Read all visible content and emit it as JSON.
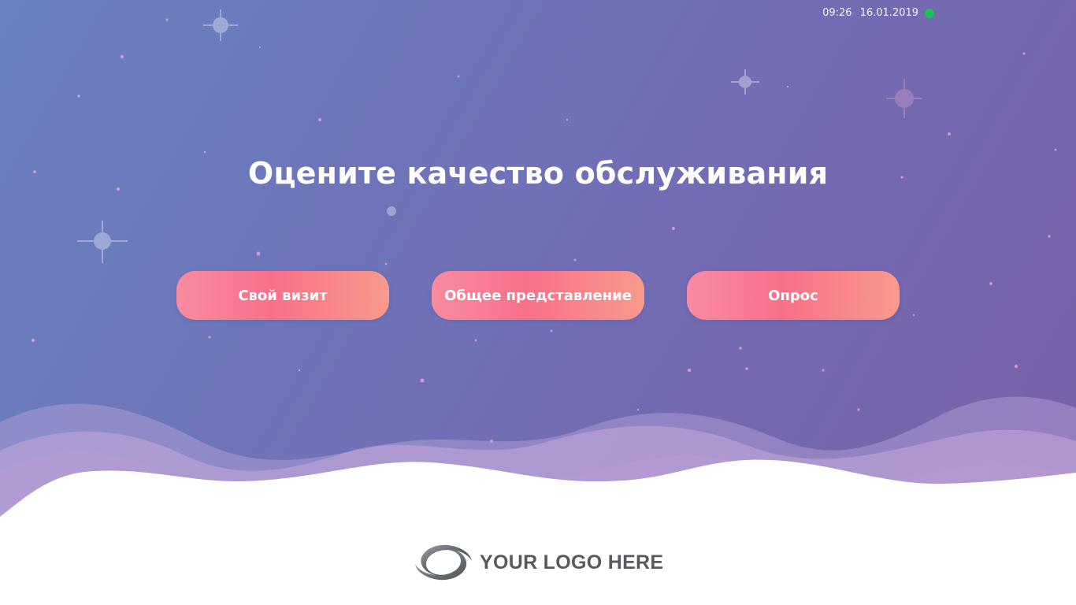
{
  "status": {
    "time": "09:26",
    "date": "16.01.2019",
    "online_color": "#1fbf5a"
  },
  "title": "Оцените качество обслуживания",
  "buttons": [
    {
      "label": "Свой визит"
    },
    {
      "label": "Общее представление"
    },
    {
      "label": "Опрос"
    }
  ],
  "logo": {
    "text": "YOUR LOGO HERE",
    "icon": "swirl-logo-icon"
  },
  "colors": {
    "button_gradient": [
      "#f98ba0",
      "#f7708a",
      "#f99a8b"
    ],
    "background_gradient": [
      "#6a80c2",
      "#7a5fa8"
    ],
    "status_indicator": "#1fbf5a"
  }
}
